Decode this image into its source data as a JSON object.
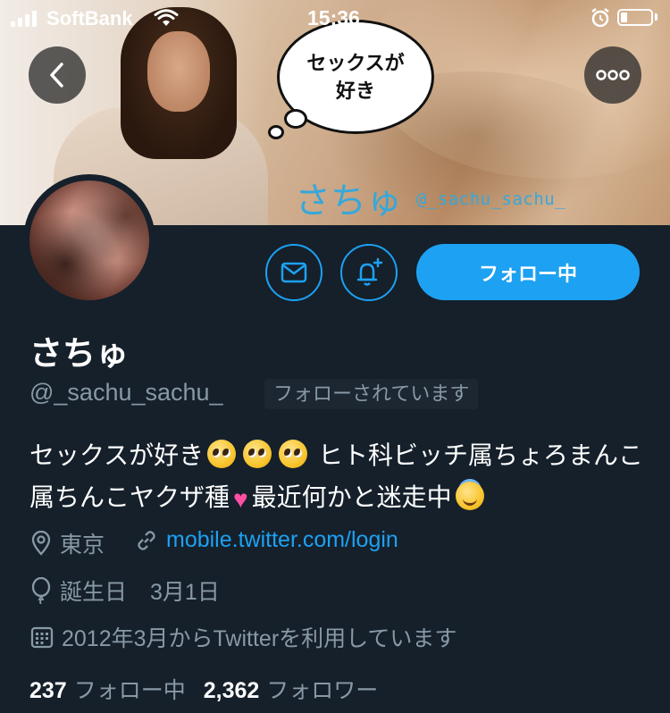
{
  "status_bar": {
    "carrier": "SoftBank",
    "time": "15:36"
  },
  "banner": {
    "bubble_text": "セックスが好き",
    "name": "さちゅ",
    "handle": "@_sachu_sachu_"
  },
  "profile": {
    "follow_button": "フォロー中",
    "display_name": "さちゅ",
    "handle": "@_sachu_sachu_",
    "follows_you": "フォローされています",
    "bio": {
      "part1": "セックスが好き",
      "part2": " ヒト科ビッチ属ちょろまんこ属ちんこヤクザ種",
      "part3": "最近何かと迷走中"
    },
    "location": "東京",
    "link": "mobile.twitter.com/login",
    "birthday_label": "誕生日",
    "birthday": "3月1日",
    "joined": "2012年3月からTwitterを利用しています"
  },
  "stats": {
    "following_count": "237",
    "following_label": "フォロー中",
    "followers_count": "2,362",
    "followers_label": "フォロワー"
  },
  "icons": [
    "back-arrow-icon",
    "more-icon",
    "mail-icon",
    "bell-plus-icon",
    "location-pin-icon",
    "link-icon",
    "balloon-icon",
    "calendar-icon",
    "wifi-icon",
    "alarm-icon",
    "pleading-face-emoji",
    "heart-emoji",
    "angel-face-emoji"
  ],
  "colors": {
    "background": "#15202b",
    "accent": "#1da1f2",
    "secondary_text": "#8899a6"
  }
}
